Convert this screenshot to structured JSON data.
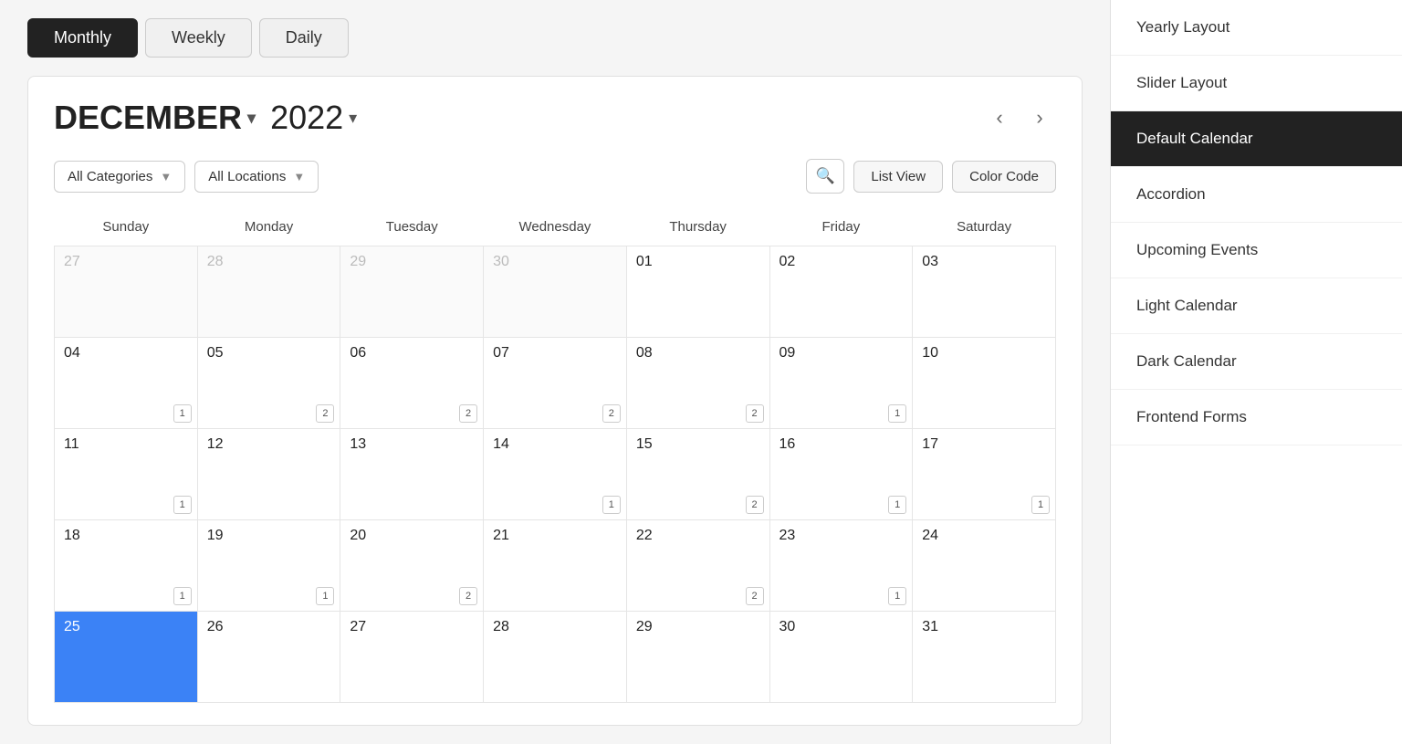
{
  "view_toggle": {
    "monthly": "Monthly",
    "weekly": "Weekly",
    "daily": "Daily",
    "active": "Monthly"
  },
  "calendar": {
    "month": "DECEMBER",
    "month_arrow": "▾",
    "year": "2022",
    "year_arrow": "▾",
    "prev_label": "‹",
    "next_label": "›",
    "filters": {
      "categories_label": "All Categories",
      "locations_label": "All Locations"
    },
    "buttons": {
      "list_view": "List View",
      "color_code": "Color Code"
    },
    "weekdays": [
      "Sunday",
      "Monday",
      "Tuesday",
      "Wednesday",
      "Thursday",
      "Friday",
      "Saturday"
    ],
    "weeks": [
      [
        {
          "day": "27",
          "outside": true,
          "badge": null
        },
        {
          "day": "28",
          "outside": true,
          "badge": null
        },
        {
          "day": "29",
          "outside": true,
          "badge": null
        },
        {
          "day": "30",
          "outside": true,
          "badge": null
        },
        {
          "day": "01",
          "outside": false,
          "badge": null
        },
        {
          "day": "02",
          "outside": false,
          "badge": null
        },
        {
          "day": "03",
          "outside": false,
          "badge": null
        }
      ],
      [
        {
          "day": "04",
          "outside": false,
          "badge": "1"
        },
        {
          "day": "05",
          "outside": false,
          "badge": "2"
        },
        {
          "day": "06",
          "outside": false,
          "badge": "2"
        },
        {
          "day": "07",
          "outside": false,
          "badge": "2"
        },
        {
          "day": "08",
          "outside": false,
          "badge": "2"
        },
        {
          "day": "09",
          "outside": false,
          "badge": "1"
        },
        {
          "day": "10",
          "outside": false,
          "badge": null
        }
      ],
      [
        {
          "day": "11",
          "outside": false,
          "badge": "1"
        },
        {
          "day": "12",
          "outside": false,
          "badge": null
        },
        {
          "day": "13",
          "outside": false,
          "badge": null
        },
        {
          "day": "14",
          "outside": false,
          "badge": "1"
        },
        {
          "day": "15",
          "outside": false,
          "badge": "2"
        },
        {
          "day": "16",
          "outside": false,
          "badge": "1"
        },
        {
          "day": "17",
          "outside": false,
          "badge": "1"
        }
      ],
      [
        {
          "day": "18",
          "outside": false,
          "badge": "1"
        },
        {
          "day": "19",
          "outside": false,
          "badge": "1"
        },
        {
          "day": "20",
          "outside": false,
          "badge": "2"
        },
        {
          "day": "21",
          "outside": false,
          "badge": null
        },
        {
          "day": "22",
          "outside": false,
          "badge": "2"
        },
        {
          "day": "23",
          "outside": false,
          "badge": "1"
        },
        {
          "day": "24",
          "outside": false,
          "badge": null
        }
      ],
      [
        {
          "day": "25",
          "outside": false,
          "badge": null,
          "today": true
        },
        {
          "day": "26",
          "outside": false,
          "badge": null
        },
        {
          "day": "27",
          "outside": false,
          "badge": null
        },
        {
          "day": "28",
          "outside": false,
          "badge": null
        },
        {
          "day": "29",
          "outside": false,
          "badge": null
        },
        {
          "day": "30",
          "outside": false,
          "badge": null
        },
        {
          "day": "31",
          "outside": false,
          "badge": null
        }
      ]
    ]
  },
  "sidebar": {
    "items": [
      {
        "label": "Yearly Layout",
        "active": false
      },
      {
        "label": "Slider Layout",
        "active": false
      },
      {
        "label": "Default Calendar",
        "active": true
      },
      {
        "label": "Accordion",
        "active": false
      },
      {
        "label": "Upcoming Events",
        "active": false
      },
      {
        "label": "Light Calendar",
        "active": false
      },
      {
        "label": "Dark Calendar",
        "active": false
      },
      {
        "label": "Frontend Forms",
        "active": false
      }
    ]
  }
}
